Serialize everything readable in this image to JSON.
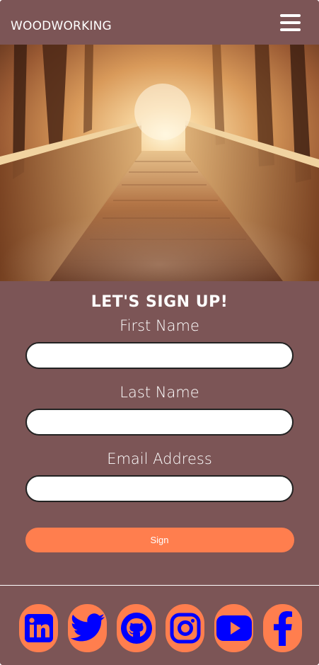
{
  "header": {
    "brand": "WOODWORKING",
    "menu_icon": "hamburger-menu-icon"
  },
  "hero": {
    "image": "forest-bridge-photo"
  },
  "form": {
    "title": "LET'S SIGN UP!",
    "fields": [
      {
        "label": "First Name",
        "value": "",
        "placeholder": ""
      },
      {
        "label": "Last Name",
        "value": "",
        "placeholder": ""
      },
      {
        "label": "Email Address",
        "value": "",
        "placeholder": ""
      }
    ],
    "submit_label": "Sign"
  },
  "footer": {
    "social_icons": [
      "linkedin-icon",
      "twitter-icon",
      "github-icon",
      "instagram-icon",
      "youtube-icon",
      "facebook-icon"
    ]
  },
  "colors": {
    "background": "#7c5556",
    "accent": "#ff7e4e",
    "icon": "#0000ff",
    "text": "#ffffff"
  }
}
